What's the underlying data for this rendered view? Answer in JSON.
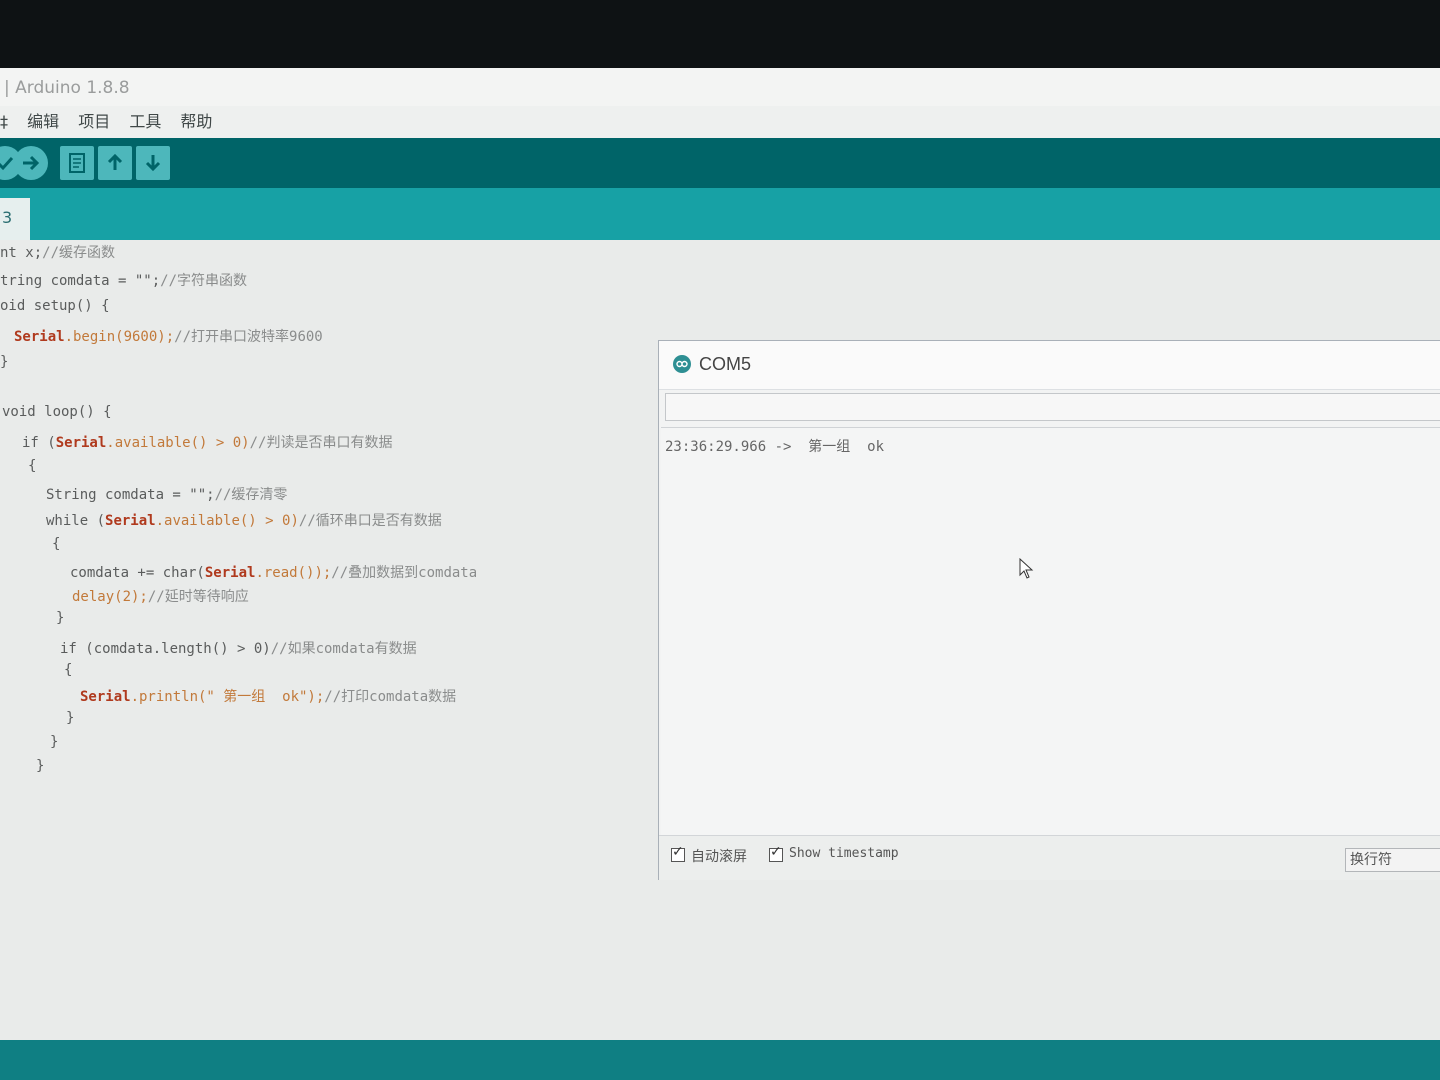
{
  "window": {
    "title": "| Arduino 1.8.8"
  },
  "menu": [
    "编辑",
    "项目",
    "工具",
    "帮助"
  ],
  "menu_partial": "‡",
  "toolbar": {
    "buttons": [
      "verify-icon",
      "upload-icon",
      "new-icon",
      "open-icon",
      "save-icon"
    ]
  },
  "tab": {
    "label": "3"
  },
  "code": {
    "l1a": "nt x;",
    "l1b": "//缓存函数",
    "l2a": "tring comdata = \"\";",
    "l2b": "//字符串函数",
    "l3": "oid setup() {",
    "l4a": "Serial",
    "l4b": ".begin(9600);",
    "l4c": "//打开串口波特率9600",
    "l5": "}",
    "l6": "void loop() {",
    "l7a": "if (",
    "l7b": "Serial",
    "l7c": ".available() > 0)",
    "l7d": "//判读是否串口有数据",
    "l8": "{",
    "l9a": "String comdata = \"\";",
    "l9b": "//缓存清零",
    "l10a": "while (",
    "l10b": "Serial",
    "l10c": ".available() > 0)",
    "l10d": "//循环串口是否有数据",
    "l11": "{",
    "l12a": "comdata += char(",
    "l12b": "Serial",
    "l12c": ".read());",
    "l12d": "//叠加数据到comdata",
    "l13a": "delay(2);",
    "l13b": "//延时等待响应",
    "l14": "}",
    "l15a": "if (comdata.length() > 0)",
    "l15b": "//如果comdata有数据",
    "l16": "{",
    "l17a": "Serial",
    "l17b": ".println(\" 第一组  ok\");",
    "l17c": "//打印comdata数据",
    "l18": "}",
    "l19": "}",
    "l20": "}"
  },
  "serial_monitor": {
    "title": "COM5",
    "input_value": "",
    "output": "23:36:29.966 ->  第一组  ok",
    "autoscroll_label": "自动滚屏",
    "timestamp_label": "Show timestamp",
    "line_ending": "换行符"
  }
}
